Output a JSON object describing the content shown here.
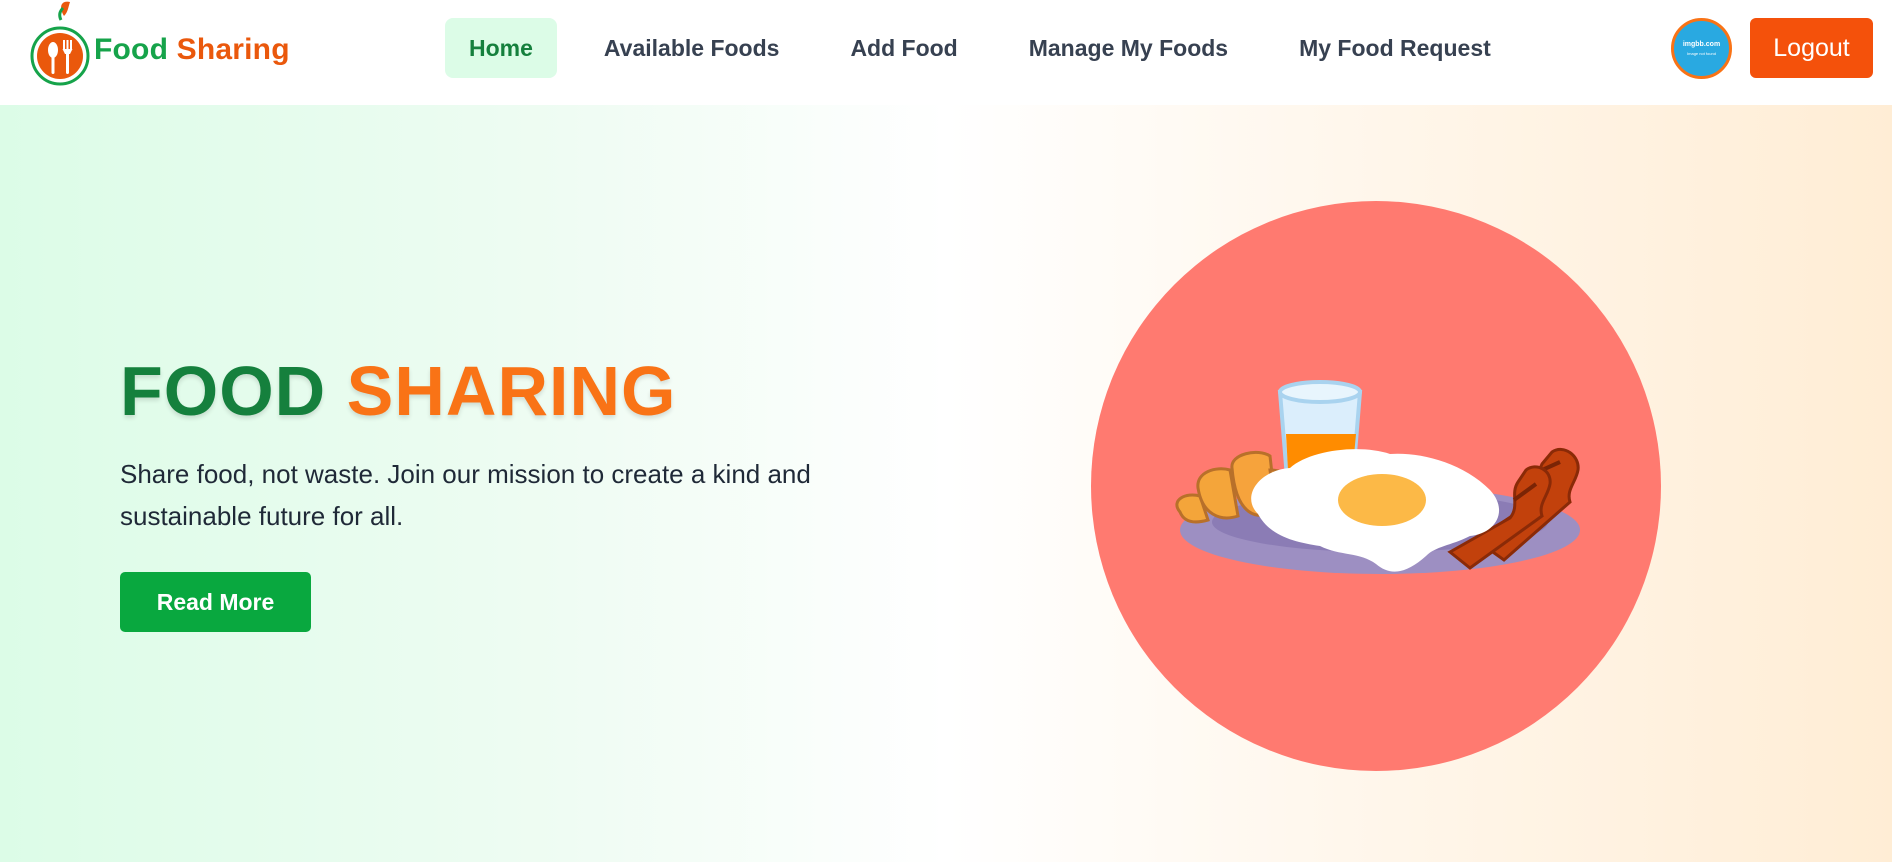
{
  "brand": {
    "word1": "Food",
    "word2": "Sharing"
  },
  "nav": {
    "items": [
      {
        "label": "Home",
        "active": true
      },
      {
        "label": "Available Foods",
        "active": false
      },
      {
        "label": "Add Food",
        "active": false
      },
      {
        "label": "Manage My Foods",
        "active": false
      },
      {
        "label": "My Food Request",
        "active": false
      }
    ]
  },
  "user": {
    "avatar_text": "imgbb.com",
    "avatar_subtext": "Image not found",
    "logout_label": "Logout"
  },
  "hero": {
    "title_part1": "FOOD",
    "title_part2": "SHARING",
    "subtitle": "Share food, not waste. Join our mission to create a kind and sustainable future for all.",
    "cta_label": "Read More",
    "illustration": "breakfast-plate-icon"
  },
  "colors": {
    "brand_green": "#16a34a",
    "brand_orange": "#ea580c",
    "logout_bg": "#f4510b",
    "cta_bg": "#09a83f",
    "nav_active_bg": "#dcfce7",
    "illustration_circle": "#ff7a70"
  }
}
